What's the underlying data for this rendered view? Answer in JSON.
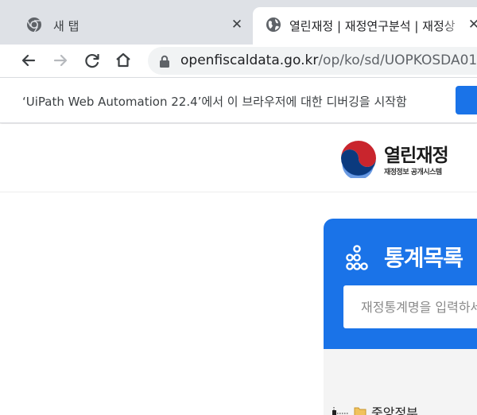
{
  "browser": {
    "tabs": [
      {
        "title": "새 탭",
        "icon": "chrome-icon",
        "active": false
      },
      {
        "title": "열린재정 | 재정연구분석 | 재정상",
        "icon": "globe-icon",
        "active": true
      }
    ],
    "close_glyph": "✕",
    "address": {
      "host": "openfiscaldata.go.kr",
      "path": "/op/ko/sd/UOPKOSDA01"
    },
    "infobar": {
      "message": "‘UiPath Web Automation 22.4’에서 이 브라우저에 대한 디버깅을 시작함"
    },
    "accent": "#1a73e8"
  },
  "site": {
    "logo": {
      "title": "열린재정",
      "subtitle": "재정정보 공개시스템"
    },
    "stat_panel": {
      "title": "통계목록",
      "icon": "circles-icon",
      "search_placeholder": "재정통계명을 입력하세요",
      "color": "#1a73e8"
    },
    "tree": {
      "items": [
        {
          "label": "중앙정부",
          "icon": "folder-icon"
        }
      ]
    }
  }
}
